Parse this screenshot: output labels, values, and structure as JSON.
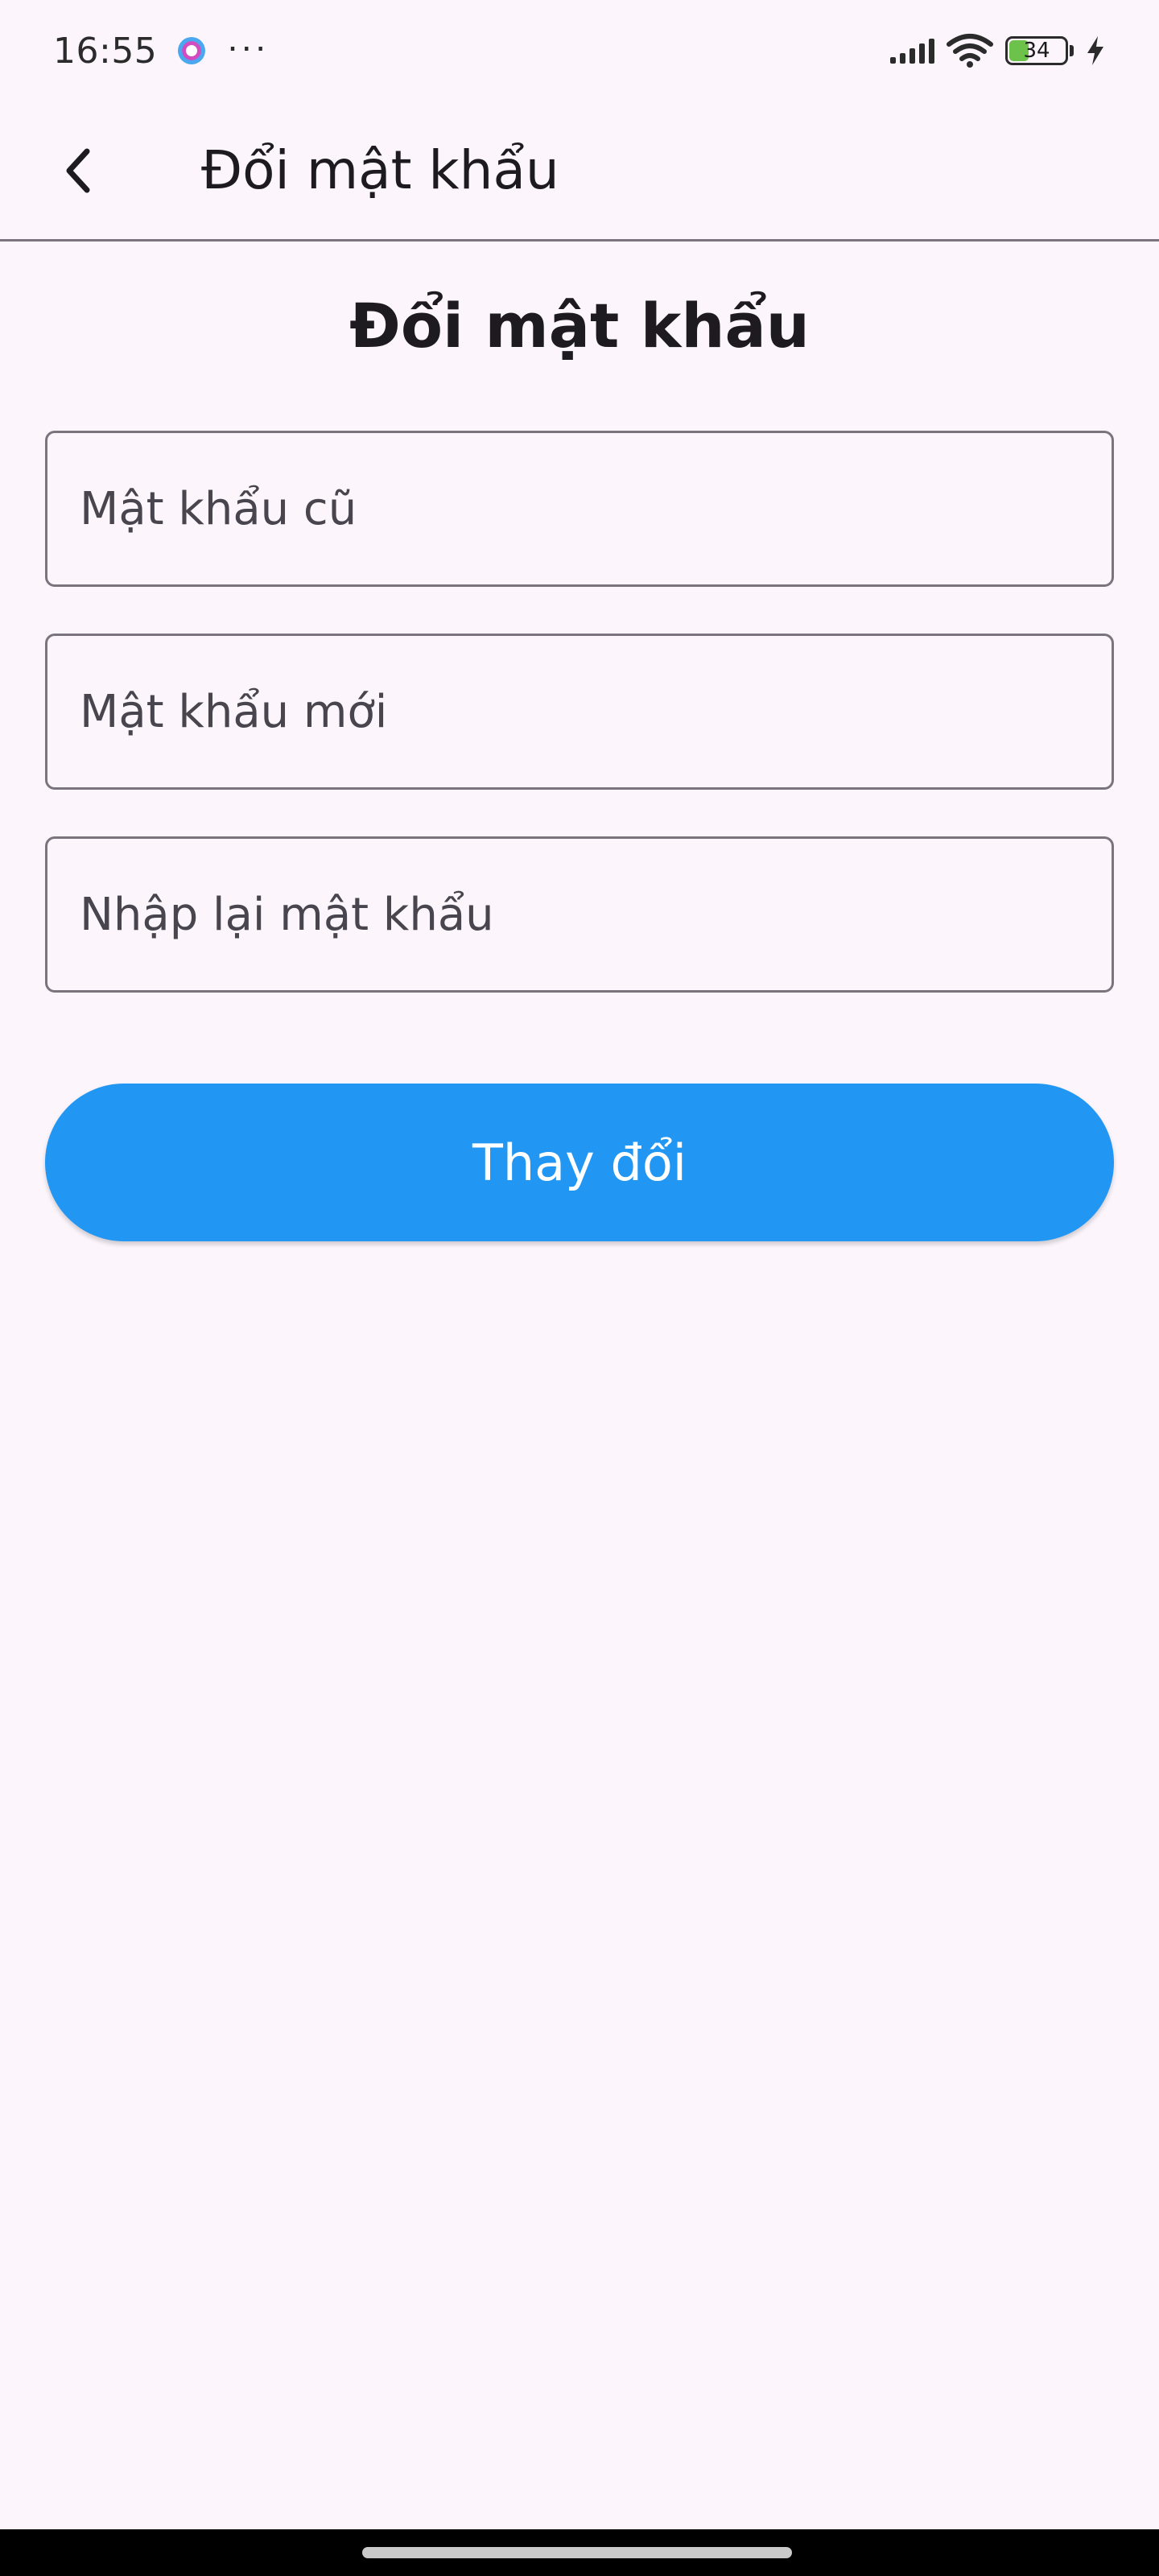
{
  "status_bar": {
    "time": "16:55",
    "more": "···",
    "battery_level": "34",
    "battery_percent": 34,
    "icons": [
      "app-notification-icon",
      "signal-icon",
      "wifi-icon",
      "battery-icon",
      "charging-icon"
    ]
  },
  "app_bar": {
    "title": "Đổi mật khẩu",
    "back_icon": "chevron-left-icon"
  },
  "main": {
    "heading": "Đổi mật khẩu",
    "fields": {
      "old_password": {
        "placeholder": "Mật khẩu cũ",
        "value": ""
      },
      "new_password": {
        "placeholder": "Mật khẩu mới",
        "value": ""
      },
      "confirm_password": {
        "placeholder": "Nhập lại mật khẩu",
        "value": ""
      }
    },
    "submit_label": "Thay đổi"
  },
  "colors": {
    "background": "#fcf6fc",
    "primary_button": "#2196f3",
    "outline": "#79747e",
    "battery_fill": "#6cc24a"
  }
}
